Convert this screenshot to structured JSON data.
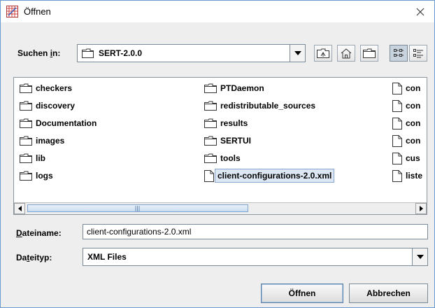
{
  "window": {
    "title": "Öffnen"
  },
  "lookin": {
    "label_prefix": "Suchen ",
    "label_mnemonic": "i",
    "label_suffix": "n:",
    "current_folder": "SERT-2.0.0"
  },
  "toolbar": {
    "up_one_level": "folder-up-icon",
    "home": "home-icon",
    "new_folder": "new-folder-icon",
    "list_view": "list-view-icon",
    "details_view": "details-view-icon"
  },
  "files": {
    "col1": [
      "checkers",
      "discovery",
      "Documentation",
      "images",
      "lib",
      "logs"
    ],
    "col2": [
      "PTDaemon",
      "redistributable_sources",
      "results",
      "SERTUI",
      "tools"
    ],
    "col2_selected": "client-configurations-2.0.xml",
    "col3": [
      "con",
      "con",
      "con",
      "con",
      "cus",
      "liste"
    ]
  },
  "filename": {
    "label_mnemonic": "D",
    "label_rest": "ateiname:",
    "value": "client-configurations-2.0.xml"
  },
  "filetype": {
    "label_prefix": "Da",
    "label_mnemonic": "t",
    "label_suffix": "eityp:",
    "value": "XML Files"
  },
  "buttons": {
    "open": "Öffnen",
    "cancel": "Abbrechen"
  },
  "colors": {
    "selection_bg": "#dce7f3",
    "selection_border": "#86a7cf",
    "window_border": "#6b9ad3"
  }
}
